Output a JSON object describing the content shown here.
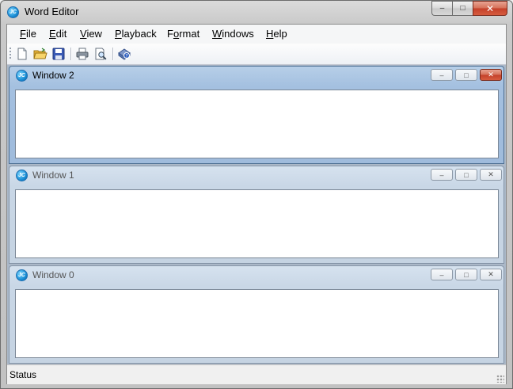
{
  "window": {
    "title": "Word Editor",
    "icon": "app-logo-icon",
    "controls": {
      "minimize": "–",
      "maximize": "□",
      "close": "✕"
    }
  },
  "menu": [
    {
      "label": "File",
      "mnemonic": "F"
    },
    {
      "label": "Edit",
      "mnemonic": "E"
    },
    {
      "label": "View",
      "mnemonic": "V"
    },
    {
      "label": "Playback",
      "mnemonic": "P"
    },
    {
      "label": "Format",
      "mnemonic": "o"
    },
    {
      "label": "Windows",
      "mnemonic": "W"
    },
    {
      "label": "Help",
      "mnemonic": "H"
    }
  ],
  "toolbar": {
    "buttons": [
      "new-document-icon",
      "open-folder-icon",
      "save-icon",
      "print-icon",
      "print-preview-icon",
      "about-help-icon"
    ]
  },
  "child_windows": [
    {
      "title": "Window 2",
      "active": true
    },
    {
      "title": "Window 1",
      "active": false
    },
    {
      "title": "Window 0",
      "active": false
    }
  ],
  "status": {
    "text": "Status"
  },
  "colors": {
    "active_caption": "#a4c0e0",
    "inactive_caption": "#c9d7e6",
    "close_red": "#c4402a",
    "mdi_background": "#abb8c8"
  }
}
